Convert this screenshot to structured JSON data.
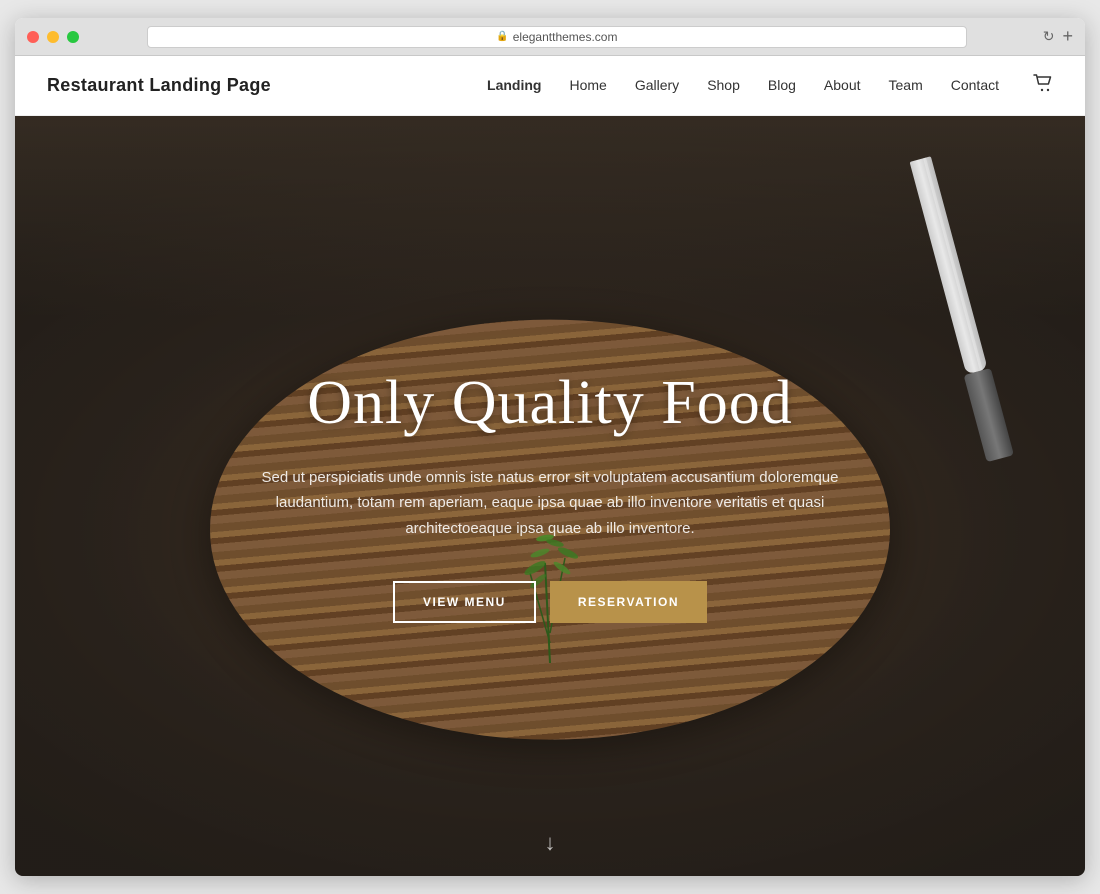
{
  "browser": {
    "url": "elegantthemes.com",
    "tab_plus": "+",
    "refresh_icon": "↻"
  },
  "nav": {
    "brand": "Restaurant Landing Page",
    "links": [
      {
        "label": "Landing",
        "active": true
      },
      {
        "label": "Home",
        "active": false
      },
      {
        "label": "Gallery",
        "active": false
      },
      {
        "label": "Shop",
        "active": false
      },
      {
        "label": "Blog",
        "active": false
      },
      {
        "label": "About",
        "active": false
      },
      {
        "label": "Team",
        "active": false
      },
      {
        "label": "Contact",
        "active": false
      }
    ],
    "cart_icon": "🛒"
  },
  "hero": {
    "title": "Only Quality Food",
    "subtitle": "Sed ut perspiciatis unde omnis iste natus error sit voluptatem accusantium doloremque laudantium, totam rem aperiam, eaque ipsa quae ab illo inventore veritatis et quasi architectoeaque ipsa quae ab illo inventore.",
    "btn_menu": "VIEW MENU",
    "btn_reservation": "RESERVATiOn",
    "scroll_arrow": "↓"
  }
}
